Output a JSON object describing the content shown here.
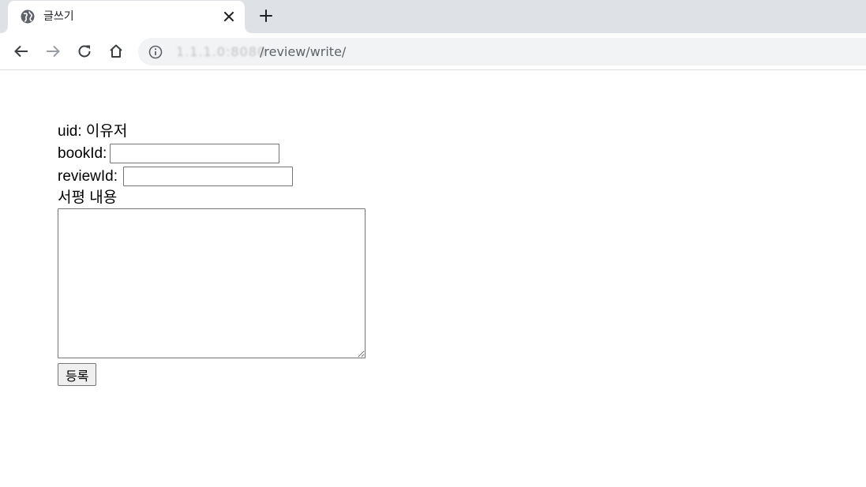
{
  "browser": {
    "tab": {
      "title": "글쓰기"
    },
    "address": {
      "host": "1.1.1.0:8080",
      "path": "/review/write/"
    }
  },
  "form": {
    "uid_label": "uid:",
    "uid_value": "이유저",
    "book_id_label": "bookId:",
    "book_id_value": "",
    "review_id_label": "reviewId:",
    "review_id_value": "",
    "content_label": "서평 내용",
    "content_value": "",
    "submit_label": "등록"
  }
}
